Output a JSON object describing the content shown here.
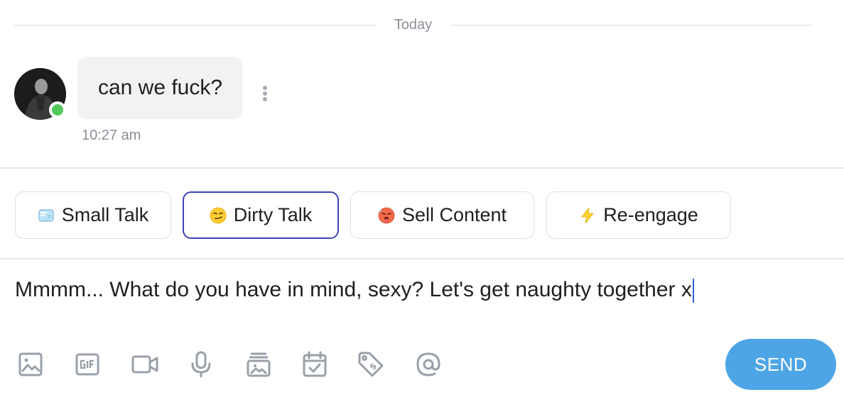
{
  "divider": {
    "label": "Today"
  },
  "message": {
    "text": "can we fuck?",
    "time": "10:27 am",
    "sender_online": true
  },
  "suggestions": [
    {
      "icon": "ice-cube-icon",
      "label": "Small Talk",
      "active": false
    },
    {
      "icon": "smirk-emoji-icon",
      "label": "Dirty Talk",
      "active": true
    },
    {
      "icon": "hot-face-emoji-icon",
      "label": "Sell Content",
      "active": false
    },
    {
      "icon": "lightning-icon",
      "label": "Re-engage",
      "active": false
    }
  ],
  "composer": {
    "value": "Mmmm... What do you have in mind, sexy? Let's get naughty together x"
  },
  "toolbar": {
    "icons": [
      "image-icon",
      "gif-icon",
      "video-icon",
      "microphone-icon",
      "vault-icon",
      "schedule-icon",
      "price-tag-icon",
      "mention-icon"
    ],
    "send_label": "SEND"
  },
  "colors": {
    "accent": "#3b44b8",
    "send": "#4ea5e6",
    "online": "#52c95c",
    "bubble": "#f1f2f4",
    "icon": "#9aa0a8"
  }
}
